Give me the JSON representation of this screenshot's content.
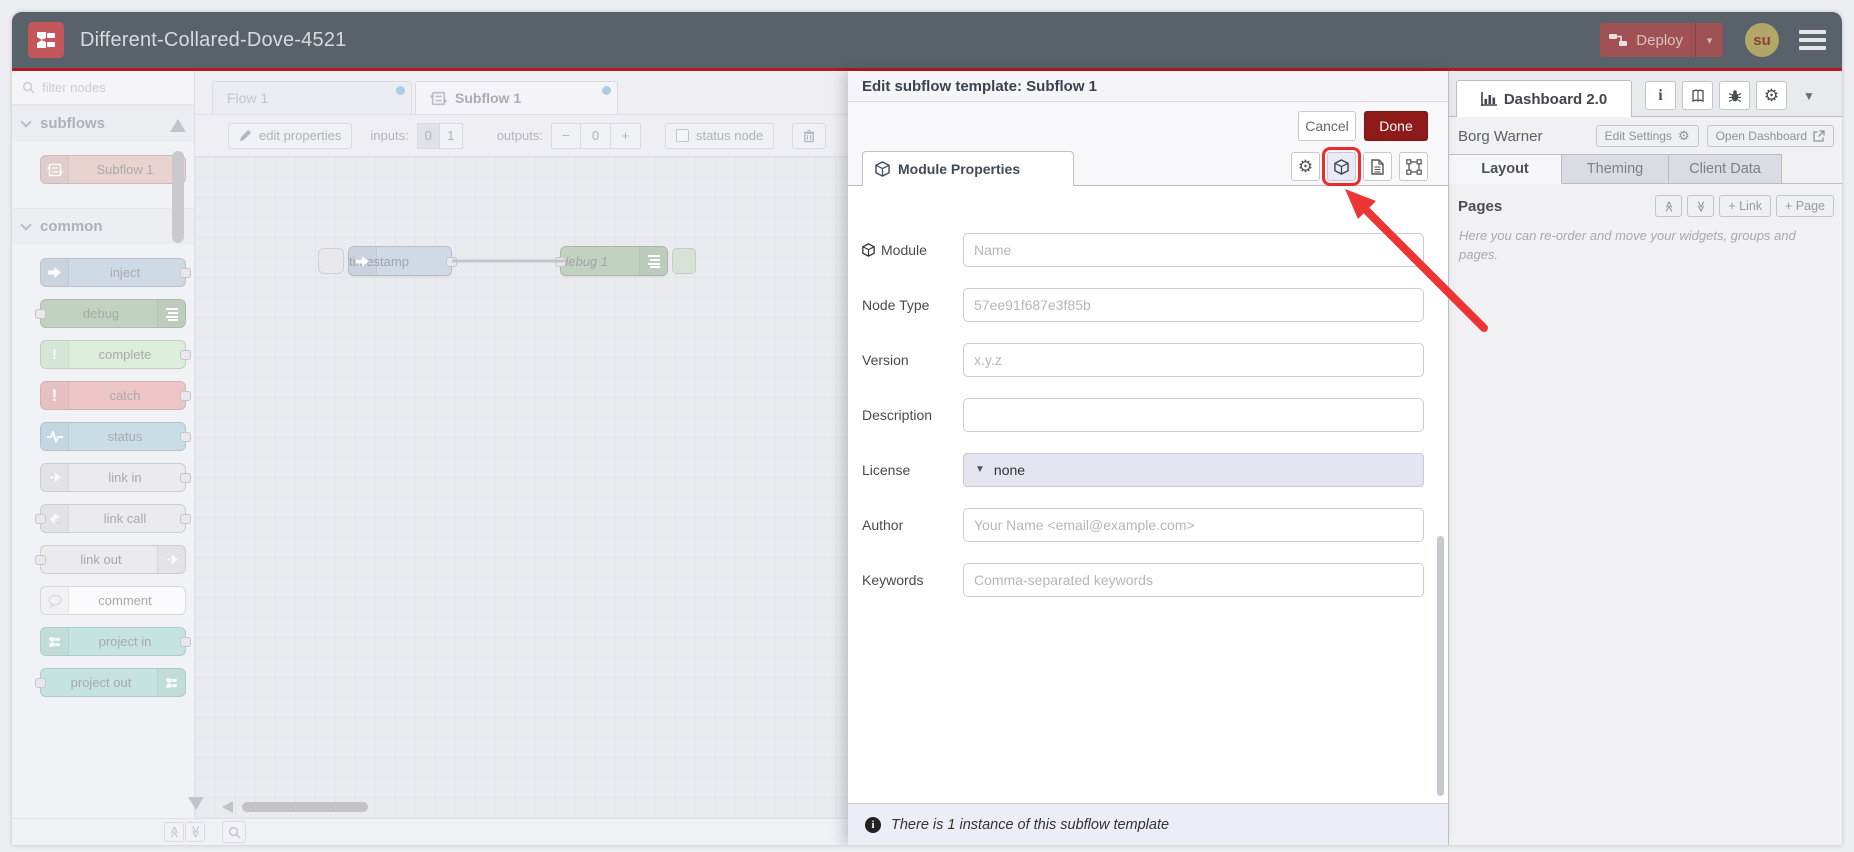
{
  "header": {
    "title": "Different-Collared-Dove-4521",
    "deploy_label": "Deploy",
    "avatar_initials": "su"
  },
  "palette": {
    "search_placeholder": "filter nodes",
    "section_subflows": "subflows",
    "section_common": "common",
    "subflow_node_label": "Subflow 1",
    "nodes": {
      "inject": "inject",
      "debug": "debug",
      "complete": "complete",
      "catch": "catch",
      "status": "status",
      "link_in": "link in",
      "link_call": "link call",
      "link_out": "link out",
      "comment": "comment",
      "project_in": "project in",
      "project_out": "project out"
    }
  },
  "workspace": {
    "tabs": {
      "flow1": "Flow 1",
      "subflow1": "Subflow 1"
    },
    "toolbar": {
      "edit_properties": "edit properties",
      "inputs_label": "inputs:",
      "inputs_option_0": "0",
      "inputs_option_1": "1",
      "outputs_label": "outputs:",
      "outputs_minus": "−",
      "outputs_value": "0",
      "outputs_plus": "+",
      "status_node": "status node"
    },
    "nodes": {
      "timestamp": "timestamp",
      "debug1": "debug 1"
    }
  },
  "dialog": {
    "title": "Edit subflow template: Subflow 1",
    "cancel": "Cancel",
    "done": "Done",
    "tab_label": "Module Properties",
    "fields": {
      "module": {
        "label": "Module",
        "placeholder": "Name"
      },
      "node_type": {
        "label": "Node Type",
        "placeholder": "57ee91f687e3f85b"
      },
      "version": {
        "label": "Version",
        "placeholder": "x.y.z"
      },
      "description": {
        "label": "Description",
        "placeholder": ""
      },
      "license": {
        "label": "License",
        "value": "none"
      },
      "author": {
        "label": "Author",
        "placeholder": "Your Name <email@example.com>"
      },
      "keywords": {
        "label": "Keywords",
        "placeholder": "Comma-separated keywords"
      }
    },
    "footer_text": "There is 1 instance of this subflow template"
  },
  "sidebar": {
    "tab_label": "Dashboard 2.0",
    "project_name": "Borg Warner",
    "edit_settings": "Edit Settings",
    "open_dashboard": "Open Dashboard",
    "tab_layout": "Layout",
    "tab_theming": "Theming",
    "tab_client_data": "Client Data",
    "pages_title": "Pages",
    "add_link": "+ Link",
    "add_page": "+ Page",
    "help_text": "Here you can re-order and move your widgets, groups and pages."
  },
  "colors": {
    "accent_red": "#b11a22",
    "annotation_red": "#ee2b2b",
    "header_bg": "#59616b",
    "deploy_bg": "#a05154",
    "done_bg": "#8f1a1a",
    "avatar_bg": "#b2a768",
    "node_inject": "#a6bbcf",
    "node_debug": "#87a980",
    "node_complete": "#c0e3bc",
    "node_catch": "#e49191",
    "node_status": "#94c1d0",
    "node_link": "#dddddd",
    "node_comment": "#ffffff",
    "node_project": "#8fd0c0",
    "node_subflow": "#d7aba4",
    "unsaved_dot": "#54a2c6"
  }
}
